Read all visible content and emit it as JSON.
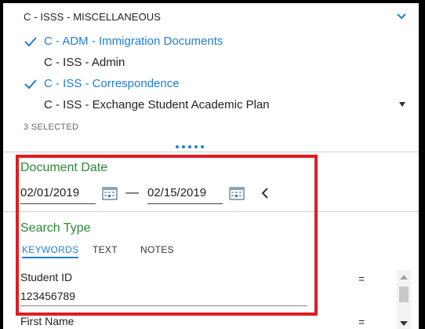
{
  "category": {
    "header": "C - ISSS - MISCELLANEOUS",
    "items": [
      {
        "label": "C - ADM - Immigration Documents",
        "selected": true
      },
      {
        "label": "C - ISS - Admin",
        "selected": false
      },
      {
        "label": "C - ISS - Correspondence",
        "selected": true
      },
      {
        "label": "C - ISS - Exchange Student Academic Plan",
        "selected": false
      }
    ],
    "selected_count": "3 SELECTED"
  },
  "document_date": {
    "title": "Document Date",
    "from": "02/01/2019",
    "separator": "—",
    "to": "02/15/2019"
  },
  "search_type": {
    "title": "Search Type",
    "tabs": [
      {
        "label": "KEYWORDS",
        "active": true
      },
      {
        "label": "TEXT",
        "active": false
      },
      {
        "label": "NOTES",
        "active": false
      }
    ]
  },
  "fields": [
    {
      "label": "Student ID",
      "value": "123456789",
      "operator": "="
    },
    {
      "label": "First Name",
      "value": "",
      "operator": "="
    }
  ],
  "icons": {
    "check": "checkmark-icon",
    "chevron": "chevron-down-icon",
    "calendar": "calendar-icon",
    "back": "chevron-left-icon"
  },
  "colors": {
    "accent": "#1f7ed6",
    "section_title": "#2a8a37",
    "highlight": "#e01b24"
  }
}
